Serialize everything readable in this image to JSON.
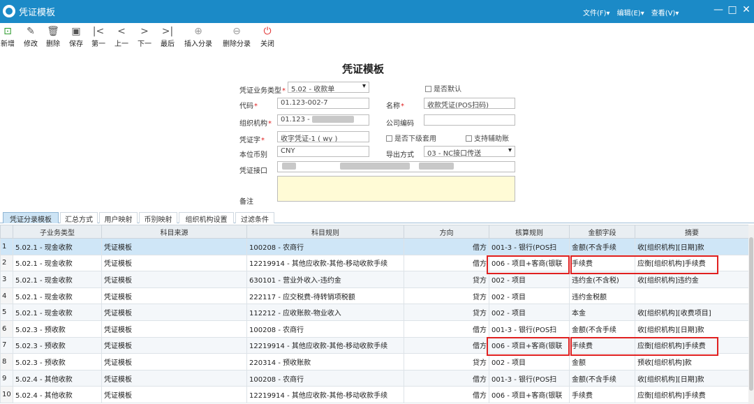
{
  "window": {
    "title": "凭证模板",
    "menus": [
      "文件(F)▾",
      "编辑(E)▾",
      "查看(V)▾"
    ],
    "controls": [
      "—",
      "□",
      "✕"
    ]
  },
  "toolbar": [
    {
      "label": "新增",
      "icon": "add-doc-icon",
      "glyph": "⊡"
    },
    {
      "label": "修改",
      "icon": "edit-icon",
      "glyph": "✎"
    },
    {
      "label": "删除",
      "icon": "trash-icon",
      "glyph": "🗑"
    },
    {
      "label": "保存",
      "icon": "save-icon",
      "glyph": "▣"
    },
    {
      "label": "第一",
      "icon": "first-icon",
      "glyph": "|<"
    },
    {
      "label": "上一",
      "icon": "prev-icon",
      "glyph": "<"
    },
    {
      "label": "下一",
      "icon": "next-icon",
      "glyph": ">"
    },
    {
      "label": "最后",
      "icon": "last-icon",
      "glyph": ">|"
    },
    {
      "label": "插入分录",
      "icon": "plus-circle-icon",
      "glyph": "⊕"
    },
    {
      "label": "删除分录",
      "icon": "minus-circle-icon",
      "glyph": "⊖"
    },
    {
      "label": "关闭",
      "icon": "power-icon",
      "glyph": "⏻"
    }
  ],
  "form": {
    "title": "凭证模板",
    "biz_type_label": "凭证业务类型",
    "biz_type_value": "5.02 - 收款单",
    "is_default_label": "是否默认",
    "code_label": "代码",
    "code_value": "01.123-002-7",
    "name_label": "名称",
    "name_value": "收款凭证(POS扫码)",
    "org_label": "组织机构",
    "org_value": "01.123 -",
    "company_code_label": "公司编码",
    "company_code_value": "",
    "voucher_word_label": "凭证字",
    "voucher_word_value": "收字凭证-1 ( wy )",
    "sub_apply_label": "是否下级套用",
    "aux_label": "支持辅助账",
    "currency_label": "本位币别",
    "currency_value": "CNY",
    "export_label": "导出方式",
    "export_value": "03 - NC接口传送",
    "interface_label": "凭证接口",
    "note_label": "备注",
    "required_mark": "*"
  },
  "tabs": [
    "凭证分录模板",
    "汇总方式",
    "用户映射",
    "币别映射",
    "组织机构设置",
    "过滤条件"
  ],
  "grid": {
    "columns": [
      "",
      "子业务类型",
      "科目来源",
      "科目规则",
      "方向",
      "核算规则",
      "金额字段",
      "摘要"
    ],
    "rows": [
      [
        "1",
        "5.02.1 - 现金收款",
        "凭证模板",
        "100208 - 农商行",
        "借方",
        "001-3 - 银行(POS扫",
        "金额(不含手续",
        "收[组织机构][日期]款"
      ],
      [
        "2",
        "5.02.1 - 现金收款",
        "凭证模板",
        "12219914 - 其他应收款-其他-移动收款手续",
        "借方",
        "006 - 项目+客商(银联",
        "手续费",
        "应衡[组织机构]手续费"
      ],
      [
        "3",
        "5.02.1 - 现金收款",
        "凭证模板",
        "630101 - 营业外收入-违约金",
        "贷方",
        "002 - 项目",
        "违约金(不含税)",
        "收[组织机构]违约金"
      ],
      [
        "4",
        "5.02.1 - 现金收款",
        "凭证模板",
        "222117 - 应交税费-待转销项税额",
        "贷方",
        "002 - 项目",
        "违约金税额",
        ""
      ],
      [
        "5",
        "5.02.1 - 现金收款",
        "凭证模板",
        "112212 - 应收账款-物业收入",
        "贷方",
        "002 - 项目",
        "本金",
        "收[组织机构][收费项目]"
      ],
      [
        "6",
        "5.02.3 - 预收款",
        "凭证模板",
        "100208 - 农商行",
        "借方",
        "001-3 - 银行(POS扫",
        "金额(不含手续",
        "收[组织机构][日期]款"
      ],
      [
        "7",
        "5.02.3 - 预收款",
        "凭证模板",
        "12219914 - 其他应收款-其他-移动收款手续",
        "借方",
        "006 - 项目+客商(银联",
        "手续费",
        "应衡[组织机构]手续费"
      ],
      [
        "8",
        "5.02.3 - 预收款",
        "凭证模板",
        "220314 - 预收账款",
        "贷方",
        "002 - 项目",
        "金额",
        "预收[组织机构]款"
      ],
      [
        "9",
        "5.02.4 - 其他收款",
        "凭证模板",
        "100208 - 农商行",
        "借方",
        "001-3 - 银行(POS扫",
        "金额(不含手续",
        "收[组织机构][日期]款"
      ],
      [
        "10",
        "5.02.4 - 其他收款",
        "凭证模板",
        "12219914 - 其他应收款-其他-移动收款手续",
        "借方",
        "006 - 项目+客商(银联",
        "手续费",
        "应衡[组织机构]手续费"
      ]
    ]
  },
  "colors": {
    "titlebar": "#1b8ac7",
    "highlight": "#e02020",
    "selected_row": "#cfe6f7"
  }
}
